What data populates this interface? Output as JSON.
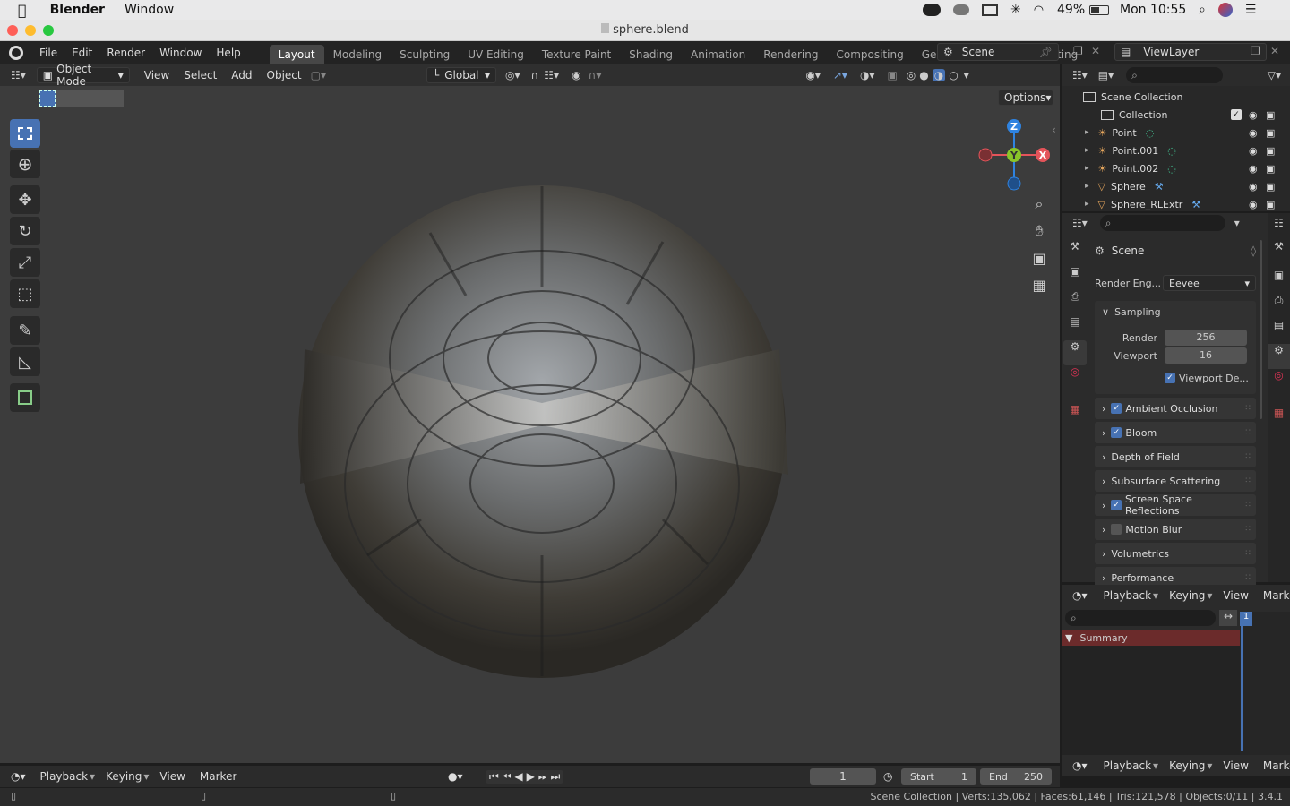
{
  "macos": {
    "app_name": "Blender",
    "menu_window": "Window",
    "battery": "49%",
    "clock": "Mon 10:55"
  },
  "window": {
    "title": "sphere.blend"
  },
  "topbar": {
    "menus": [
      "File",
      "Edit",
      "Render",
      "Window",
      "Help"
    ],
    "workspaces": [
      "Layout",
      "Modeling",
      "Sculpting",
      "UV Editing",
      "Texture Paint",
      "Shading",
      "Animation",
      "Rendering",
      "Compositing",
      "Geometry Nodes",
      "Scripting"
    ],
    "active_workspace": "Layout",
    "scene": "Scene",
    "view_layer": "ViewLayer"
  },
  "viewport": {
    "mode": "Object Mode",
    "menus": [
      "View",
      "Select",
      "Add",
      "Object"
    ],
    "orientation": "Global",
    "options_label": "Options",
    "gizmo": {
      "z": "Z",
      "y": "Y",
      "x": "X"
    }
  },
  "outliner": {
    "root": "Scene Collection",
    "collection": "Collection",
    "items": [
      "Point",
      "Point.001",
      "Point.002",
      "Sphere",
      "Sphere_RLExtr"
    ]
  },
  "properties": {
    "context": "Scene",
    "render_engine_label": "Render Eng...",
    "render_engine": "Eevee",
    "sampling_label": "Sampling",
    "render_label": "Render",
    "render_samples": "256",
    "viewport_label": "Viewport",
    "viewport_samples": "16",
    "viewport_denoise": "Viewport De...",
    "panels": [
      {
        "label": "Ambient Occlusion",
        "checkbox": true,
        "checked": true
      },
      {
        "label": "Bloom",
        "checkbox": true,
        "checked": true
      },
      {
        "label": "Depth of Field",
        "checkbox": false,
        "checked": false
      },
      {
        "label": "Subsurface Scattering",
        "checkbox": false,
        "checked": false
      },
      {
        "label": "Screen Space Reflections",
        "checkbox": true,
        "checked": true
      },
      {
        "label": "Motion Blur",
        "checkbox": true,
        "checked": false
      },
      {
        "label": "Volumetrics",
        "checkbox": false,
        "checked": false
      },
      {
        "label": "Performance",
        "checkbox": false,
        "checked": false
      }
    ]
  },
  "dopesheet": {
    "menus": [
      "Playback",
      "Keying",
      "View",
      "Marker"
    ],
    "summary": "Summary",
    "frame_marker": "1"
  },
  "timeline": {
    "menus": [
      "Playback",
      "Keying",
      "View",
      "Marker"
    ],
    "current_frame": "1",
    "start_label": "Start",
    "start": "1",
    "end_label": "End",
    "end": "250"
  },
  "status": {
    "text": "Scene Collection | Verts:135,062 | Faces:61,146 | Tris:121,578 | Objects:0/11 | 3.4.1"
  },
  "colors": {
    "accent": "#4772b3",
    "viewport_bg": "#3c3c3c",
    "gizmo_x": "#e4545a",
    "gizmo_y": "#8ac529",
    "gizmo_z": "#2f83e0",
    "summary_bg": "#6b2b2b"
  }
}
